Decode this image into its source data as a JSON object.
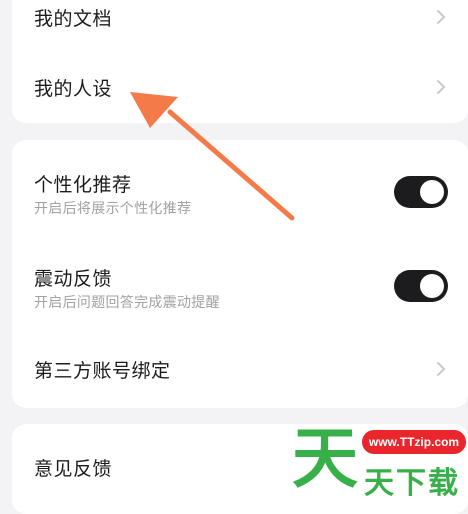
{
  "card1": {
    "items": [
      {
        "label": "我的文档"
      },
      {
        "label": "我的人设"
      }
    ]
  },
  "card2": {
    "personalized": {
      "label": "个性化推荐",
      "desc": "开启后将展示个性化推荐",
      "on": true
    },
    "vibration": {
      "label": "震动反馈",
      "desc": "开启后问题回答完成震动提醒",
      "on": true
    },
    "third_party": {
      "label": "第三方账号绑定"
    }
  },
  "card3": {
    "feedback": {
      "label": "意见反馈"
    }
  },
  "watermark": {
    "big_char": "天",
    "url": "www.TTzip.com",
    "text": "天下载"
  },
  "colors": {
    "arrow": "#f47a4a",
    "toggle_on": "#1c1c1e",
    "watermark_green": "#38b04a",
    "watermark_red": "#e8262b"
  }
}
